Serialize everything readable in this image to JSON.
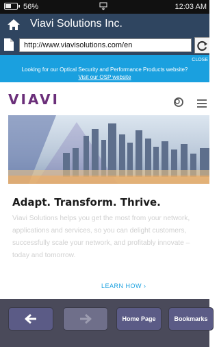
{
  "status": {
    "battery": "56%",
    "time": "12:03 AM",
    "battery_level": 0.56
  },
  "app": {
    "title": "Viavi Solutions Inc."
  },
  "address_bar": {
    "url": "http://www.viavisolutions.com/en"
  },
  "banner": {
    "close": "CLOSE",
    "text": "Looking for our Optical Security and Performance Products website?",
    "link": "Visit our OSP website"
  },
  "site": {
    "logo_text": "VIAVI"
  },
  "hero": {
    "headline": "Adapt. Transform. Thrive."
  },
  "content": {
    "body": "Viavi Solutions helps you get the most from your network, applications and services, so you can delight customers, successfully scale your network, and profitably innovate – today and tomorrow.",
    "learn_how": "LEARN HOW ›"
  },
  "toolbar": {
    "home": "Home Page",
    "bookmarks": "Bookmarks"
  },
  "colors": {
    "title_bar": "#2f4560",
    "banner": "#1aa0df",
    "toolbar": "#4a4a5a",
    "button": "#5b5b86"
  }
}
